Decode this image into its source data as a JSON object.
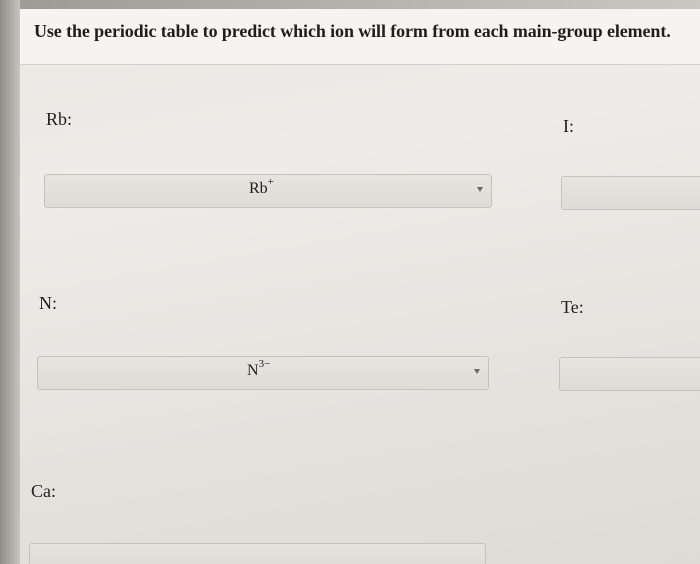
{
  "question": {
    "instruction": "Use the periodic table to predict which ion will form from each main-group element."
  },
  "items": [
    {
      "label": "Rb:",
      "symbol": "Rb",
      "charge": "+"
    },
    {
      "label": "I:",
      "symbol": "",
      "charge": ""
    },
    {
      "label": "N:",
      "symbol": "N",
      "charge": "3−"
    },
    {
      "label": "Te:",
      "symbol": "",
      "charge": ""
    },
    {
      "label": "Ca:",
      "symbol": "",
      "charge": ""
    }
  ]
}
